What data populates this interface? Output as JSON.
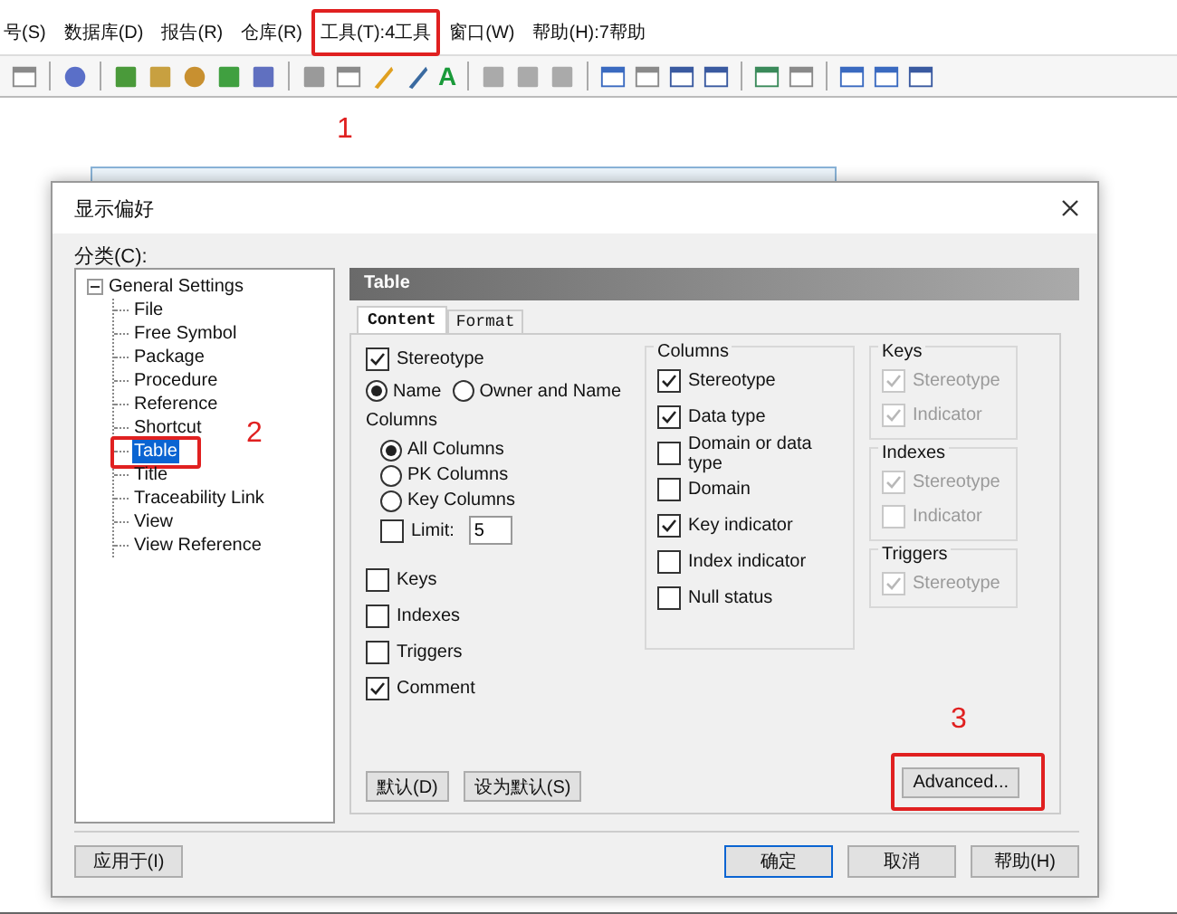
{
  "menu": {
    "items": [
      {
        "label": "号(S)"
      },
      {
        "label": "数据库(D)"
      },
      {
        "label": "报告(R)"
      },
      {
        "label": "仓库(R)"
      },
      {
        "label": "工具(T):4工具"
      },
      {
        "label": "窗口(W)"
      },
      {
        "label": "帮助(H):7帮助"
      }
    ]
  },
  "toolbar": {
    "letter_icon": "A"
  },
  "annotations": [
    {
      "label": "1"
    },
    {
      "label": "2"
    },
    {
      "label": "3"
    }
  ],
  "dialog": {
    "title": "显示偏好",
    "category_label": "分类(C):",
    "tree": {
      "label": "General Settings",
      "expanded": true,
      "children": [
        {
          "label": "File",
          "selected": false
        },
        {
          "label": "Free Symbol",
          "selected": false
        },
        {
          "label": "Package",
          "selected": false
        },
        {
          "label": "Procedure",
          "selected": false
        },
        {
          "label": "Reference",
          "selected": false
        },
        {
          "label": "Shortcut",
          "selected": false
        },
        {
          "label": "Table",
          "selected": true
        },
        {
          "label": "Title",
          "selected": false
        },
        {
          "label": "Traceability Link",
          "selected": false
        },
        {
          "label": "View",
          "selected": false
        },
        {
          "label": "View Reference",
          "selected": false
        }
      ]
    },
    "panel_title": "Table",
    "tabs": [
      {
        "label": "Content",
        "selected": true
      },
      {
        "label": "Format",
        "selected": false
      }
    ],
    "content": {
      "stereotype": {
        "label": "Stereotype",
        "checked": true
      },
      "name_options": [
        {
          "label": "Name",
          "selected": true
        },
        {
          "label": "Owner and Name",
          "selected": false
        }
      ],
      "columns_label": "Columns",
      "column_options": [
        {
          "label": "All Columns",
          "selected": true
        },
        {
          "label": "PK Columns",
          "selected": false
        },
        {
          "label": "Key Columns",
          "selected": false
        }
      ],
      "limit": {
        "label": "Limit:",
        "checked": false,
        "value": "5"
      },
      "toggles": [
        {
          "label": "Keys",
          "checked": false
        },
        {
          "label": "Indexes",
          "checked": false
        },
        {
          "label": "Triggers",
          "checked": false
        },
        {
          "label": "Comment",
          "checked": true
        }
      ],
      "columns_group": {
        "title": "Columns",
        "items": [
          {
            "label": "Stereotype",
            "checked": true
          },
          {
            "label": "Data type",
            "checked": true
          },
          {
            "label": "Domain or data type",
            "checked": false
          },
          {
            "label": "Domain",
            "checked": false
          },
          {
            "label": "Key indicator",
            "checked": true
          },
          {
            "label": "Index indicator",
            "checked": false
          },
          {
            "label": "Null status",
            "checked": false
          }
        ]
      },
      "side_groups": [
        {
          "title": "Keys",
          "items": [
            {
              "label": "Stereotype",
              "checked": true,
              "disabled": true
            },
            {
              "label": "Indicator",
              "checked": true,
              "disabled": true
            }
          ]
        },
        {
          "title": "Indexes",
          "items": [
            {
              "label": "Stereotype",
              "checked": true,
              "disabled": true
            },
            {
              "label": "Indicator",
              "checked": false,
              "disabled": true
            }
          ]
        },
        {
          "title": "Triggers",
          "items": [
            {
              "label": "Stereotype",
              "checked": true,
              "disabled": true
            }
          ]
        }
      ],
      "default_buttons": [
        {
          "label": "默认(D)"
        },
        {
          "label": "设为默认(S)"
        }
      ],
      "advanced": "Advanced..."
    },
    "apply": "应用于(I)",
    "actions": [
      {
        "label": "确定",
        "default": true
      },
      {
        "label": "取消",
        "default": false
      },
      {
        "label": "帮助(H)",
        "default": false
      }
    ]
  }
}
